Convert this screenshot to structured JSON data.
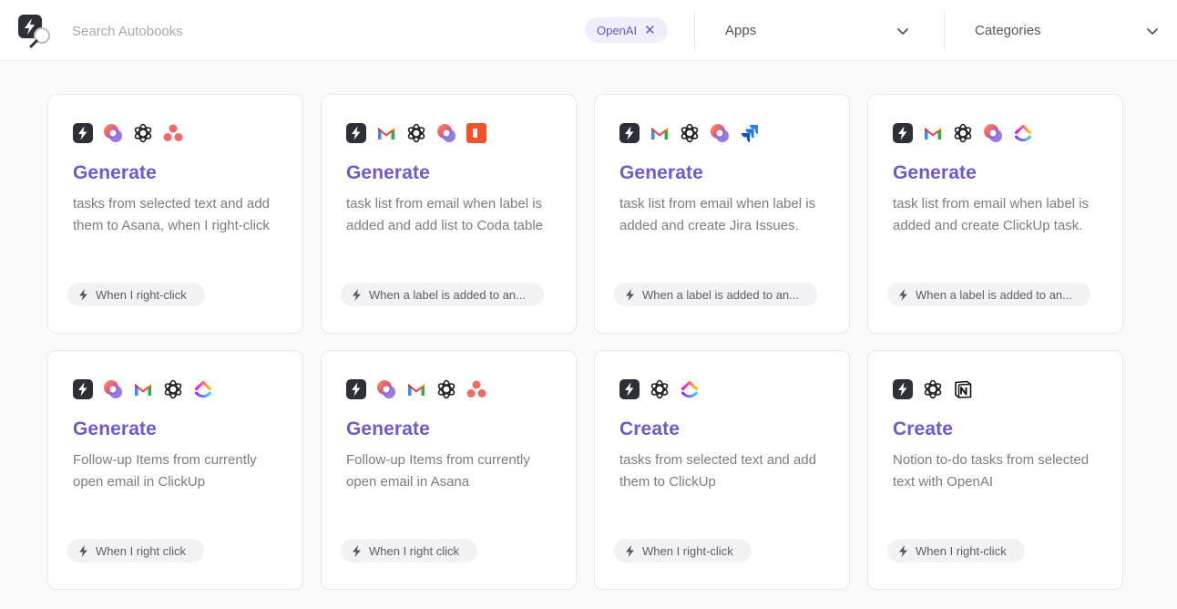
{
  "header": {
    "search_placeholder": "Search Autobooks",
    "filter_chip": "OpenAI",
    "apps_label": "Apps",
    "categories_label": "Categories"
  },
  "icon_legend": {
    "bolt": "bolt-icon",
    "loop": "microsoft-loop-icon",
    "openai": "openai-icon",
    "asana": "asana-icon",
    "gmail": "gmail-icon",
    "coda": "coda-icon",
    "jira": "jira-icon",
    "clickup": "clickup-icon",
    "notion": "notion-icon"
  },
  "colors": {
    "accent": "#7259c6",
    "chip_bg": "#f1eefb"
  },
  "cards": [
    {
      "icons": [
        "bolt",
        "loop",
        "openai",
        "asana"
      ],
      "title": "Generate",
      "desc": "tasks from selected text and add them to Asana, when I right-click",
      "trigger": "When I right-click"
    },
    {
      "icons": [
        "bolt",
        "gmail",
        "openai",
        "loop",
        "coda"
      ],
      "title": "Generate",
      "desc": "task list from email when label is added and add list to Coda table",
      "trigger": "When a label is added to an..."
    },
    {
      "icons": [
        "bolt",
        "gmail",
        "openai",
        "loop",
        "jira"
      ],
      "title": "Generate",
      "desc": "task list from email when label is added and create Jira Issues.",
      "trigger": "When a label is added to an..."
    },
    {
      "icons": [
        "bolt",
        "gmail",
        "openai",
        "loop",
        "clickup"
      ],
      "title": "Generate",
      "desc": "task list from email when label is added and create ClickUp task.",
      "trigger": "When a label is added to an..."
    },
    {
      "icons": [
        "bolt",
        "loop",
        "gmail",
        "openai",
        "clickup"
      ],
      "title": "Generate",
      "desc": "Follow-up Items from currently open email in ClickUp",
      "trigger": "When I right click"
    },
    {
      "icons": [
        "bolt",
        "loop",
        "gmail",
        "openai",
        "asana"
      ],
      "title": "Generate",
      "desc": "Follow-up Items from currently open email in Asana",
      "trigger": "When I right click"
    },
    {
      "icons": [
        "bolt",
        "openai",
        "clickup"
      ],
      "title": "Create",
      "desc": "tasks from selected text and add them to ClickUp",
      "trigger": "When I right-click"
    },
    {
      "icons": [
        "bolt",
        "openai",
        "notion"
      ],
      "title": "Create",
      "desc": "Notion to-do tasks from selected text with OpenAI",
      "trigger": "When I right-click"
    }
  ]
}
